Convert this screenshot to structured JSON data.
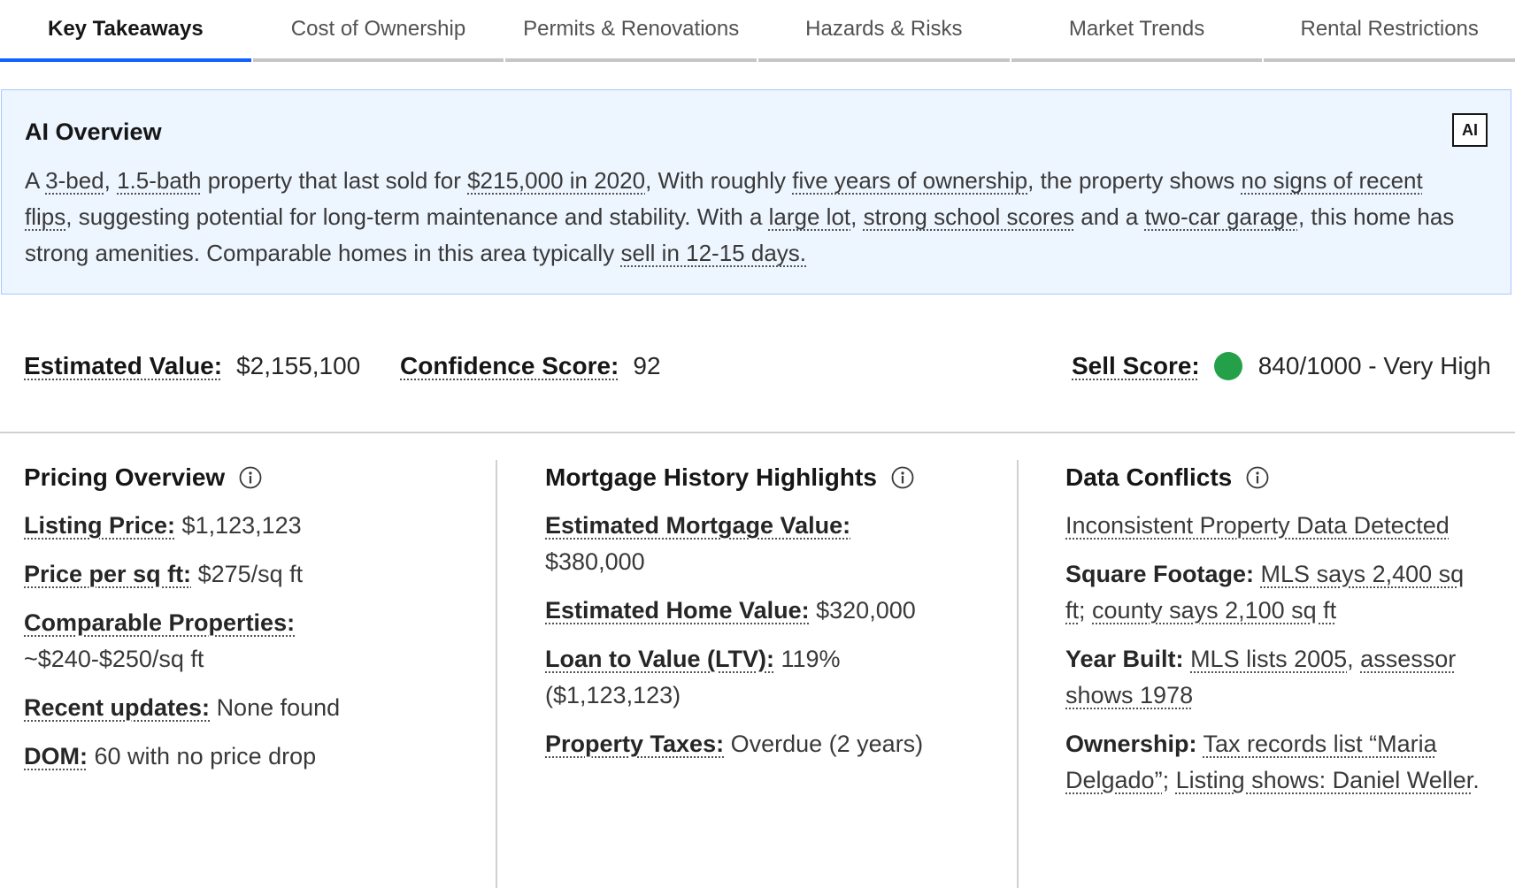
{
  "tabs": [
    {
      "label": "Key Takeaways"
    },
    {
      "label": "Cost of Ownership"
    },
    {
      "label": "Permits & Renovations"
    },
    {
      "label": "Hazards & Risks"
    },
    {
      "label": "Market Trends"
    },
    {
      "label": "Rental Restrictions"
    }
  ],
  "overview": {
    "title": "AI Overview",
    "badge": "AI",
    "t0": "A ",
    "u0": "3-bed",
    "t1": ", ",
    "u1": "1.5-bath",
    "t2": " property that last sold for ",
    "u2": "$215,000 in 2020",
    "t3": ", With roughly ",
    "u3": "five years of ownership",
    "t4": ", the property shows ",
    "u4": "no signs of recent flips",
    "t5": ", suggesting potential for long-term maintenance and stability. With a ",
    "u5": "large lot",
    "t6": ", ",
    "u6": "strong school scores",
    "t7": " and a ",
    "u7": "two-car garage",
    "t8": ", this home has strong amenities. Comparable homes in this area typically ",
    "u8": "sell in 12-15 days."
  },
  "scores": {
    "estimated_value_label": "Estimated Value:",
    "estimated_value": "$2,155,100",
    "confidence_label": "Confidence Score:",
    "confidence": "92",
    "sell_label": "Sell Score:",
    "sell": "840/1000 - Very High",
    "sell_color": "#24a148"
  },
  "pricing": {
    "title": "Pricing Overview",
    "listing_label": "Listing Price:",
    "listing": "$1,123,123",
    "ppsf_label": "Price per sq ft:",
    "ppsf": "$275/sq ft",
    "comp_label": "Comparable Properties:",
    "comp": "~$240-$250/sq ft",
    "updates_label": "Recent updates:",
    "updates": "None found",
    "dom_label": "DOM:",
    "dom": "60 with no price drop"
  },
  "mortgage": {
    "title": "Mortgage History Highlights",
    "emv_label": "Estimated Mortgage Value:",
    "emv": "$380,000",
    "ehv_label": "Estimated Home Value:",
    "ehv": "$320,000",
    "ltv_label": "Loan to Value (LTV):",
    "ltv": "119% ($1,123,123)",
    "tax_label": "Property Taxes:",
    "tax": "Overdue (2 years)"
  },
  "conflicts": {
    "title": "Data Conflicts",
    "headline": "Inconsistent Property Data Detected",
    "sqft_label": "Square Footage:",
    "sqft_a": "MLS says 2,400 sq ft",
    "sqft_sep": "; ",
    "sqft_b": "county says 2,100 sq ft",
    "year_label": "Year Built:",
    "year_a": "MLS lists 2005",
    "year_sep": ", ",
    "year_b": "assessor shows 1978",
    "own_label": "Ownership:",
    "own_a": "Tax records list “Maria Delgado”",
    "own_sep": "; ",
    "own_b": "Listing shows: Daniel Weller",
    "own_end": "."
  }
}
